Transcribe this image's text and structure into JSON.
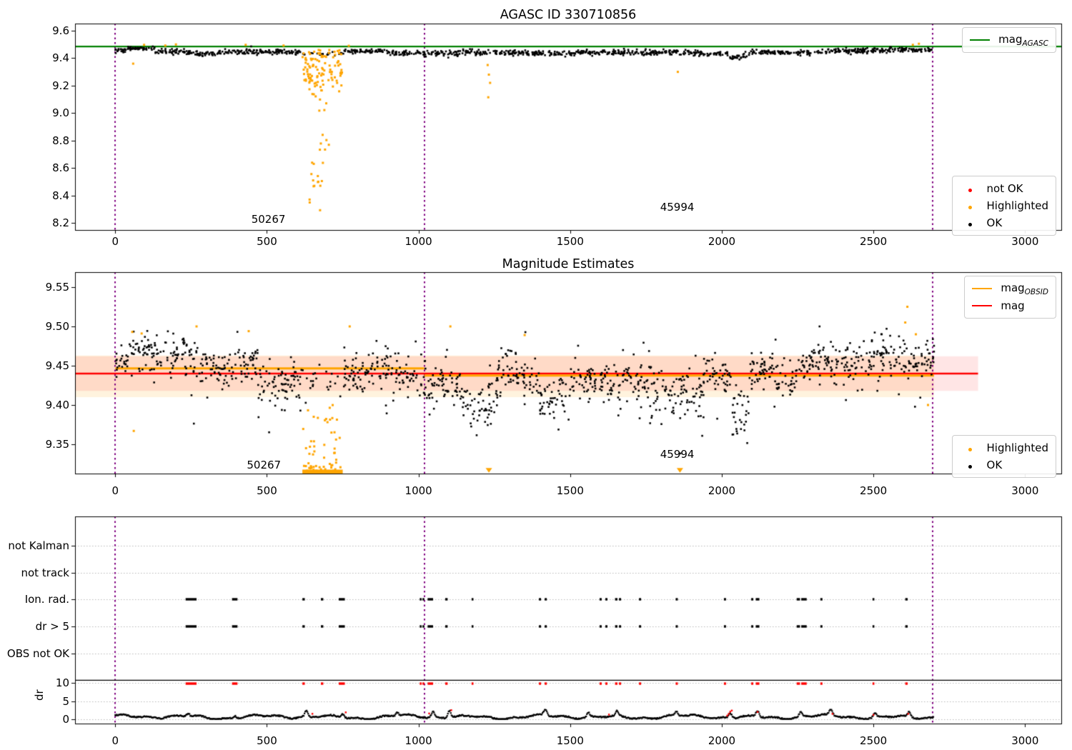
{
  "colors": {
    "green": "#008000",
    "orange": "#ffa500",
    "red": "#ff0000",
    "purple": "#800080",
    "black": "#000000",
    "grid": "#b8b8b8",
    "band_red": "rgba(255,0,0,0.10)",
    "band_orange": "rgba(255,165,0,0.13)"
  },
  "chart_data": [
    {
      "type": "scatter",
      "title": "AGASC ID 330710856",
      "xticks": [
        "0",
        "500",
        "1000",
        "1500",
        "2000",
        "2500",
        "3000"
      ],
      "xtick_values": [
        0,
        500,
        1000,
        1500,
        2000,
        2500,
        3000
      ],
      "yticks": [
        "9.6",
        "9.4",
        "9.2",
        "9.0",
        "8.8",
        "8.6",
        "8.4",
        "8.2"
      ],
      "ytick_values": [
        9.6,
        9.4,
        9.2,
        9.0,
        8.8,
        8.6,
        8.4,
        8.2
      ],
      "xlim": [
        -133,
        3120
      ],
      "ylim": [
        8.148,
        9.652
      ],
      "grid": false,
      "legend_position": [
        "upper right",
        "lower right"
      ],
      "mag_agasc_line": 9.485,
      "vlines": [
        0,
        1019,
        2695
      ],
      "annotations": [
        {
          "text": "50267",
          "x": 505,
          "y": 8.225
        },
        {
          "text": "45994",
          "x": 1853,
          "y": 8.315
        }
      ],
      "black_segments": [
        [
          0,
          40,
          9.455,
          0.008,
          1
        ],
        [
          40,
          130,
          9.468,
          0.007,
          1
        ],
        [
          130,
          260,
          9.448,
          0.01,
          1
        ],
        [
          260,
          340,
          9.434,
          0.009,
          1
        ],
        [
          340,
          480,
          9.443,
          0.01,
          1
        ],
        [
          480,
          615,
          9.448,
          0.009,
          1
        ],
        [
          615,
          755,
          9.432,
          0.008,
          0.35
        ],
        [
          755,
          900,
          9.45,
          0.009,
          1
        ],
        [
          900,
          1010,
          9.443,
          0.009,
          1
        ],
        [
          1010,
          1130,
          9.43,
          0.01,
          1
        ],
        [
          1130,
          1360,
          9.442,
          0.01,
          1
        ],
        [
          1360,
          1520,
          9.432,
          0.009,
          1
        ],
        [
          1520,
          1750,
          9.443,
          0.01,
          1
        ],
        [
          1750,
          2020,
          9.437,
          0.01,
          1
        ],
        [
          2020,
          2090,
          9.412,
          0.01,
          1
        ],
        [
          2090,
          2300,
          9.44,
          0.01,
          1
        ],
        [
          2300,
          2550,
          9.452,
          0.009,
          1
        ],
        [
          2550,
          2700,
          9.462,
          0.009,
          1
        ]
      ],
      "orange_cluster": {
        "x0": 615,
        "x1": 748,
        "n": 110,
        "mean": 9.33,
        "spread": 0.09,
        "ymax": 9.46
      },
      "orange_tail": {
        "x0": 640,
        "x1": 705,
        "n": 28,
        "ylo": 8.27,
        "yhi": 9.18
      },
      "orange_singles": [
        [
          59,
          9.36
        ],
        [
          95,
          9.497
        ],
        [
          165,
          9.492
        ],
        [
          200,
          9.5
        ],
        [
          430,
          9.497
        ],
        [
          555,
          9.492
        ],
        [
          770,
          9.49
        ],
        [
          1228,
          9.35
        ],
        [
          1232,
          9.28
        ],
        [
          1236,
          9.22
        ],
        [
          1230,
          9.115
        ],
        [
          1855,
          9.3
        ],
        [
          2630,
          9.497
        ],
        [
          2650,
          9.505
        ]
      ]
    },
    {
      "type": "scatter",
      "title": "Magnitude Estimates",
      "xticks": [
        "0",
        "500",
        "1000",
        "1500",
        "2000",
        "2500",
        "3000"
      ],
      "xtick_values": [
        0,
        500,
        1000,
        1500,
        2000,
        2500,
        3000
      ],
      "yticks": [
        "9.55",
        "9.50",
        "9.45",
        "9.40",
        "9.35"
      ],
      "ytick_values": [
        9.55,
        9.5,
        9.45,
        9.4,
        9.35
      ],
      "xlim": [
        -133,
        3120
      ],
      "ylim": [
        9.3127,
        9.57
      ],
      "grid": false,
      "mag_line": {
        "y": 9.44,
        "x0": -133,
        "x1": 2845
      },
      "mag_obsid_segments": [
        [
          0,
          1019,
          9.4465
        ],
        [
          1019,
          2700,
          9.4375
        ]
      ],
      "band_red": {
        "ylo": 9.418,
        "yhi": 9.462,
        "x0": -133,
        "x1": 2845
      },
      "band_orange": {
        "ylo": 9.41,
        "yhi": 9.463,
        "x0": -133,
        "x1": 2700
      },
      "vlines": [
        0,
        1019,
        2695
      ],
      "annotations": [
        {
          "text": "50267",
          "x": 490,
          "y": 9.324
        },
        {
          "text": "45994",
          "x": 1853,
          "y": 9.337
        }
      ],
      "black_segments": [
        [
          0,
          45,
          9.452,
          0.008,
          1
        ],
        [
          45,
          230,
          9.468,
          0.012,
          1
        ],
        [
          230,
          330,
          9.452,
          0.012,
          1
        ],
        [
          330,
          470,
          9.448,
          0.012,
          1
        ],
        [
          470,
          570,
          9.425,
          0.013,
          1
        ],
        [
          570,
          620,
          9.44,
          0.01,
          1
        ],
        [
          620,
          755,
          9.43,
          0.008,
          0.3
        ],
        [
          755,
          1010,
          9.442,
          0.012,
          1
        ],
        [
          1010,
          1140,
          9.425,
          0.013,
          1
        ],
        [
          1140,
          1260,
          9.408,
          0.015,
          1
        ],
        [
          1260,
          1400,
          9.44,
          0.013,
          1
        ],
        [
          1400,
          1500,
          9.41,
          0.016,
          1
        ],
        [
          1500,
          1620,
          9.437,
          0.013,
          1
        ],
        [
          1620,
          1780,
          9.428,
          0.014,
          1
        ],
        [
          1780,
          1940,
          9.415,
          0.015,
          1
        ],
        [
          1940,
          2030,
          9.438,
          0.012,
          1
        ],
        [
          2030,
          2090,
          9.395,
          0.014,
          1
        ],
        [
          2090,
          2250,
          9.438,
          0.013,
          1
        ],
        [
          2250,
          2450,
          9.452,
          0.013,
          1
        ],
        [
          2450,
          2700,
          9.462,
          0.015,
          1
        ]
      ],
      "orange_cluster": {
        "x0": 618,
        "x1": 748,
        "n": 55,
        "ylo": 9.316,
        "yhi": 9.405
      },
      "orange_bottom_bar": {
        "x0": 617,
        "x1": 750,
        "y": 9.3155
      },
      "orange_singles": [
        [
          56,
          9.493
        ],
        [
          87,
          9.491
        ],
        [
          61,
          9.367
        ],
        [
          268,
          9.5
        ],
        [
          440,
          9.494
        ],
        [
          773,
          9.5
        ],
        [
          1105,
          9.5
        ],
        [
          1350,
          9.489
        ],
        [
          2605,
          9.505
        ],
        [
          2612,
          9.525
        ],
        [
          2640,
          9.49
        ],
        [
          2680,
          9.4
        ]
      ],
      "orange_triangles": [
        [
          1232,
          9.317
        ],
        [
          1862,
          9.317
        ]
      ]
    },
    {
      "type": "scatter",
      "title": "",
      "xticks": [
        "0",
        "500",
        "1000",
        "1500",
        "2000",
        "2500",
        "3000"
      ],
      "xtick_values": [
        0,
        500,
        1000,
        1500,
        2000,
        2500,
        3000
      ],
      "categories": [
        "not Kalman",
        "not track",
        "Ion. rad.",
        "dr > 5",
        "OBS not OK"
      ],
      "dr_ticks": [
        "10",
        "5",
        "0"
      ],
      "dr_tick_values": [
        10,
        5,
        0
      ],
      "ylabel": "dr",
      "grid": true,
      "vlines": [
        0,
        1019,
        2695
      ],
      "flag_rows": [
        "Ion. rad.",
        "dr > 5"
      ],
      "flag_ranges": [
        [
          232,
          268
        ],
        [
          385,
          403
        ],
        [
          617,
          625
        ],
        [
          678,
          686
        ],
        [
          737,
          757
        ],
        [
          1004,
          1010
        ],
        [
          1013,
          1019
        ],
        [
          1030,
          1048
        ],
        [
          1088,
          1096
        ],
        [
          1175,
          1179
        ],
        [
          1397,
          1404
        ],
        [
          1416,
          1423
        ],
        [
          1597,
          1604
        ],
        [
          1616,
          1623
        ],
        [
          1648,
          1656
        ],
        [
          1661,
          1668
        ],
        [
          1727,
          1734
        ],
        [
          1848,
          1855
        ],
        [
          2007,
          2014
        ],
        [
          2097,
          2104
        ],
        [
          2112,
          2124
        ],
        [
          2247,
          2258
        ],
        [
          2262,
          2280
        ],
        [
          2325,
          2332
        ],
        [
          2497,
          2501
        ],
        [
          2605,
          2613
        ]
      ],
      "dr_clip_value": 9.8,
      "dr_separator": 10.7,
      "dr_trace": {
        "x0": 0,
        "x1": 2700,
        "base": 0.65,
        "noise": 0.35,
        "max": 2.6
      },
      "dr_spikes": [
        [
          240,
          0.8
        ],
        [
          395,
          0.7
        ],
        [
          630,
          1.6
        ],
        [
          750,
          1.0
        ],
        [
          930,
          0.9
        ],
        [
          1048,
          1.5
        ],
        [
          1102,
          2.0
        ],
        [
          1418,
          1.5
        ],
        [
          1560,
          1.2
        ],
        [
          1655,
          1.3
        ],
        [
          1850,
          1.0
        ],
        [
          2028,
          1.3
        ],
        [
          2118,
          1.7
        ],
        [
          2260,
          1.2
        ],
        [
          2360,
          1.6
        ],
        [
          2505,
          1.1
        ],
        [
          2618,
          1.3
        ]
      ],
      "dr_red_points": [
        [
          650,
          1.5
        ],
        [
          760,
          1.9
        ],
        [
          1035,
          1.6
        ],
        [
          1108,
          2.5
        ],
        [
          1628,
          1.3
        ],
        [
          2018,
          1.0
        ],
        [
          2023,
          1.5
        ],
        [
          2028,
          2.1
        ],
        [
          2033,
          2.4
        ],
        [
          2118,
          2.0
        ],
        [
          2365,
          1.5
        ],
        [
          2500,
          1.2
        ],
        [
          2615,
          1.5
        ]
      ]
    }
  ],
  "legends": {
    "mag_agasc": {
      "main": "mag",
      "sub": "AGASC"
    },
    "mag_obsid": {
      "main": "mag",
      "sub": "OBSID"
    },
    "mag": {
      "main": "mag"
    },
    "points_top": [
      {
        "label": "not OK",
        "color": "red"
      },
      {
        "label": "Highlighted",
        "color": "orange"
      },
      {
        "label": "OK",
        "color": "black"
      }
    ],
    "points_mid": [
      {
        "label": "Highlighted",
        "color": "orange"
      },
      {
        "label": "OK",
        "color": "black"
      }
    ]
  }
}
